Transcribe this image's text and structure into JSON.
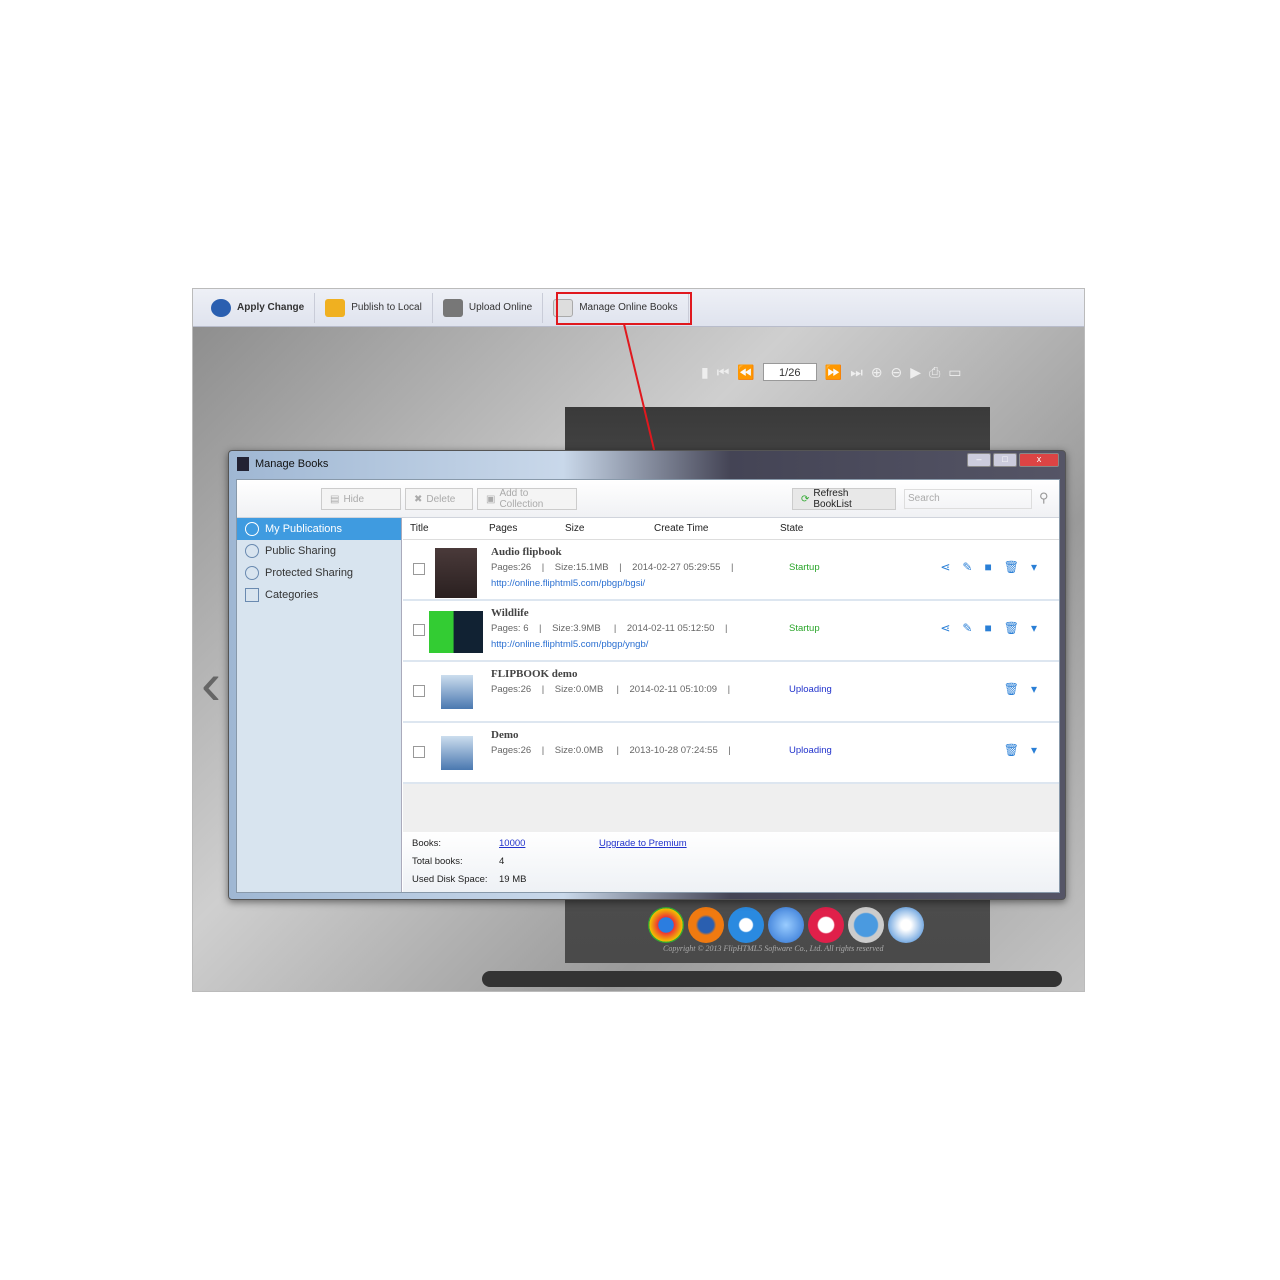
{
  "toolbar": {
    "items": [
      {
        "label": "Apply Change",
        "icon": "apply-icon"
      },
      {
        "label": "Publish to Local",
        "icon": "publish-icon"
      },
      {
        "label": "Upload Online",
        "icon": "upload-icon"
      },
      {
        "label": "Manage Online Books",
        "icon": "manage-icon"
      }
    ]
  },
  "viewer": {
    "page_indicator": "1/26",
    "copyright": "Copyright © 2013 FlipHTML5 Software Co., Ltd. All rights reserved"
  },
  "dialog": {
    "title": "Manage Books",
    "buttons": {
      "hide": "Hide",
      "delete": "Delete",
      "add_collection": "Add to Collection",
      "refresh": "Refresh BookList"
    },
    "search_placeholder": "Search",
    "sidebar": [
      {
        "label": "My Publications"
      },
      {
        "label": "Public Sharing"
      },
      {
        "label": "Protected Sharing"
      },
      {
        "label": "Categories"
      }
    ],
    "columns": [
      "Title",
      "Pages",
      "Size",
      "Create Time",
      "State"
    ],
    "books": [
      {
        "title": "Audio flipbook",
        "meta": "Pages:26    |    Size:15.1MB    |    2014-02-27 05:29:55    |",
        "state": "Startup",
        "url": "http://online.fliphtml5.com/pbgp/bgsi/"
      },
      {
        "title": "Wildlife",
        "meta": "Pages: 6    |    Size:3.9MB     |    2014-02-11 05:12:50    |",
        "state": "Startup",
        "url": "http://online.fliphtml5.com/pbgp/yngb/"
      },
      {
        "title": "FLIPBOOK demo",
        "meta": "Pages:26    |    Size:0.0MB     |    2014-02-11 05:10:09    |",
        "state": "Uploading",
        "url": ""
      },
      {
        "title": "Demo",
        "meta": "Pages:26    |    Size:0.0MB     |    2013-10-28 07:24:55    |",
        "state": "Uploading",
        "url": ""
      }
    ],
    "footer": {
      "books_label": "Books:",
      "books_value": "10000",
      "upgrade": "Upgrade to Premium",
      "total_label": "Total books:",
      "total_value": "4",
      "disk_label": "Used Disk Space:",
      "disk_value": "19 MB"
    }
  },
  "colors": {
    "highlight": "#e0181e",
    "startup": "#2aa52a",
    "uploading": "#2233cc",
    "selected": "#3f9be0"
  }
}
